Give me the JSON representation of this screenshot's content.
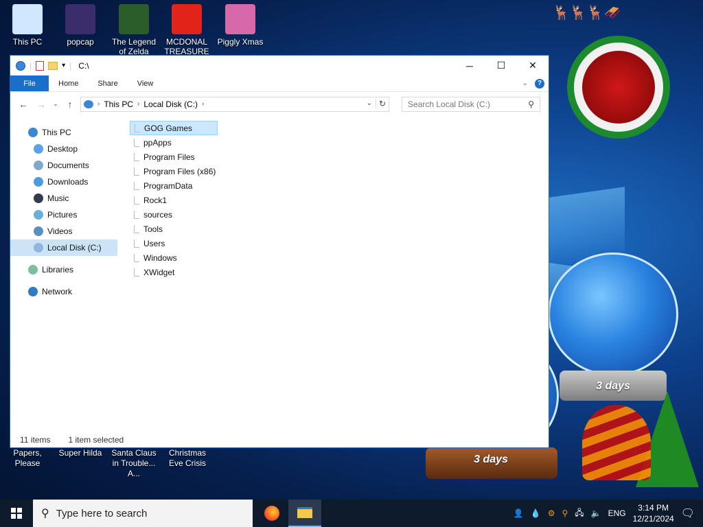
{
  "desktop": {
    "top_icons": [
      {
        "label": "This PC",
        "icon": "computer-icon"
      },
      {
        "label": "popcap",
        "icon": "folder-icon"
      },
      {
        "label": "The Legend of Zelda",
        "icon": "game-icon"
      },
      {
        "label": "MCDONAL TREASURE",
        "icon": "mcdonalds-icon"
      },
      {
        "label": "Piggly Xmas",
        "icon": "game-icon"
      }
    ],
    "bottom_icons": [
      {
        "label": "Papers, Please"
      },
      {
        "label": "Super Hilda"
      },
      {
        "label": "Santa Claus in Trouble... A..."
      },
      {
        "label": "Christmas Eve Crisis"
      }
    ],
    "globe_left_text": "3 days",
    "globe_right_text": "3 days"
  },
  "explorer": {
    "title_path": "C:\\",
    "ribbon_tabs": [
      "File",
      "Home",
      "Share",
      "View"
    ],
    "address": {
      "segments": [
        "This PC",
        "Local Disk (C:)"
      ]
    },
    "search_placeholder": "Search Local Disk (C:)",
    "nav_items": [
      {
        "label": "This PC",
        "icon": "computer-icon",
        "indent": 0
      },
      {
        "label": "Desktop",
        "icon": "desktop-icon",
        "indent": 1
      },
      {
        "label": "Documents",
        "icon": "documents-icon",
        "indent": 1
      },
      {
        "label": "Downloads",
        "icon": "downloads-icon",
        "indent": 1
      },
      {
        "label": "Music",
        "icon": "music-icon",
        "indent": 1
      },
      {
        "label": "Pictures",
        "icon": "pictures-icon",
        "indent": 1
      },
      {
        "label": "Videos",
        "icon": "videos-icon",
        "indent": 1
      },
      {
        "label": "Local Disk (C:)",
        "icon": "disk-icon",
        "indent": 1,
        "selected": true
      },
      {
        "label": "Libraries",
        "icon": "libraries-icon",
        "indent": 0
      },
      {
        "label": "Network",
        "icon": "network-icon",
        "indent": 0
      }
    ],
    "files": [
      {
        "name": "GOG Games",
        "selected": true
      },
      {
        "name": "ppApps"
      },
      {
        "name": "Program Files"
      },
      {
        "name": "Program Files (x86)"
      },
      {
        "name": "ProgramData"
      },
      {
        "name": "Rock1"
      },
      {
        "name": "sources"
      },
      {
        "name": "Tools"
      },
      {
        "name": "Users"
      },
      {
        "name": "Windows"
      },
      {
        "name": "XWidget"
      }
    ],
    "status": {
      "item_count": "11 items",
      "selection": "1 item selected"
    }
  },
  "taskbar": {
    "search_placeholder": "Type here to search",
    "language": "ENG",
    "time": "3:14 PM",
    "date": "12/21/2024"
  }
}
